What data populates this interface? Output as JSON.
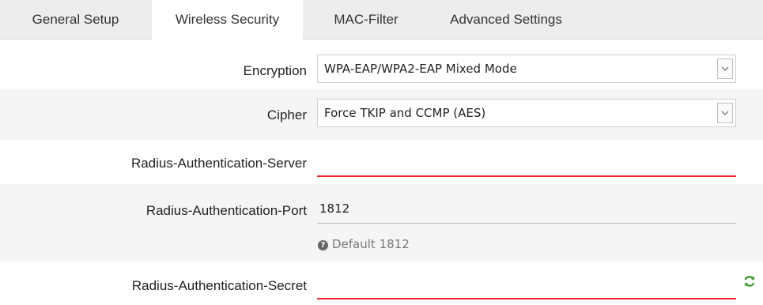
{
  "tabs": [
    {
      "label": "General Setup",
      "active": false
    },
    {
      "label": "Wireless Security",
      "active": true
    },
    {
      "label": "MAC-Filter",
      "active": false
    },
    {
      "label": "Advanced Settings",
      "active": false
    }
  ],
  "form": {
    "encryption": {
      "label": "Encryption",
      "value": "WPA-EAP/WPA2-EAP Mixed Mode"
    },
    "cipher": {
      "label": "Cipher",
      "value": "Force TKIP and CCMP (AES)"
    },
    "auth_server": {
      "label": "Radius-Authentication-Server",
      "value": ""
    },
    "auth_port": {
      "label": "Radius-Authentication-Port",
      "value": "1812",
      "hint": "Default 1812"
    },
    "auth_secret": {
      "label": "Radius-Authentication-Secret",
      "value": ""
    }
  },
  "icons": {
    "dropdown": "chevron-down-icon",
    "hint": "question-circle-icon",
    "reveal": "refresh-icon"
  },
  "colors": {
    "error_underline": "#e8242f",
    "tab_bar": "#ededed",
    "row_shade": "#f5f5f5",
    "refresh_icon": "#3a9a2a"
  }
}
